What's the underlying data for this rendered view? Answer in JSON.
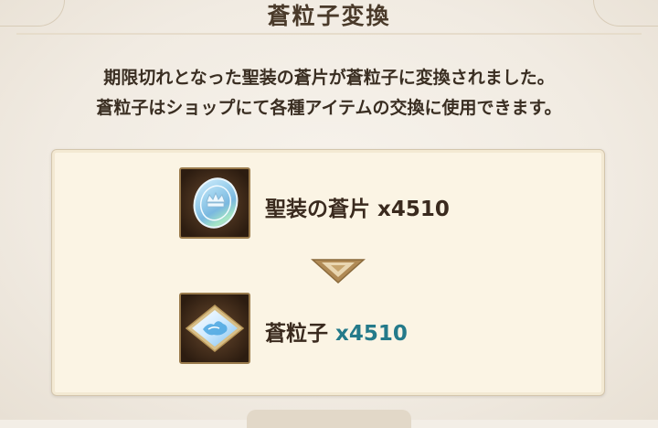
{
  "dialog": {
    "title": "蒼粒子変換",
    "description_line1": "期限切れとなった聖装の蒼片が蒼粒子に変換されました。",
    "description_line2": "蒼粒子はショップにて各種アイテムの交換に使用できます。"
  },
  "conversion": {
    "source": {
      "name": "聖装の蒼片",
      "quantity": "x4510",
      "icon": "holy-fragment-coin-icon"
    },
    "arrow_icon": "down-arrow-icon",
    "result": {
      "name": "蒼粒子",
      "quantity": "x4510",
      "icon": "blue-particle-icon",
      "quantity_color": "#247a8a"
    }
  }
}
